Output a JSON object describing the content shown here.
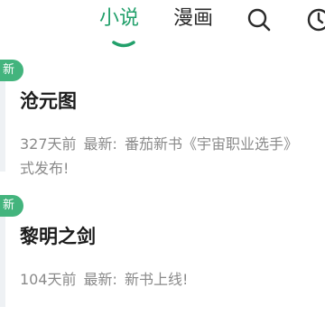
{
  "tabs": {
    "novel": "小说",
    "manga": "漫画"
  },
  "icons": {
    "search": "search-icon",
    "history": "clock-icon"
  },
  "colors": {
    "accent": "#22a06b",
    "badge": "#43b47d",
    "meta_text": "#8a8a8a"
  },
  "books": [
    {
      "badge": "新",
      "title": "沧元图",
      "days_ago": "327天前",
      "latest_label": "最新:",
      "latest_text": "番茄新书《宇宙职业选手》",
      "latest_text_cont": "式发布!"
    },
    {
      "badge": "新",
      "title": "黎明之剑",
      "days_ago": "104天前",
      "latest_label": "最新:",
      "latest_text": "新书上线!"
    }
  ]
}
